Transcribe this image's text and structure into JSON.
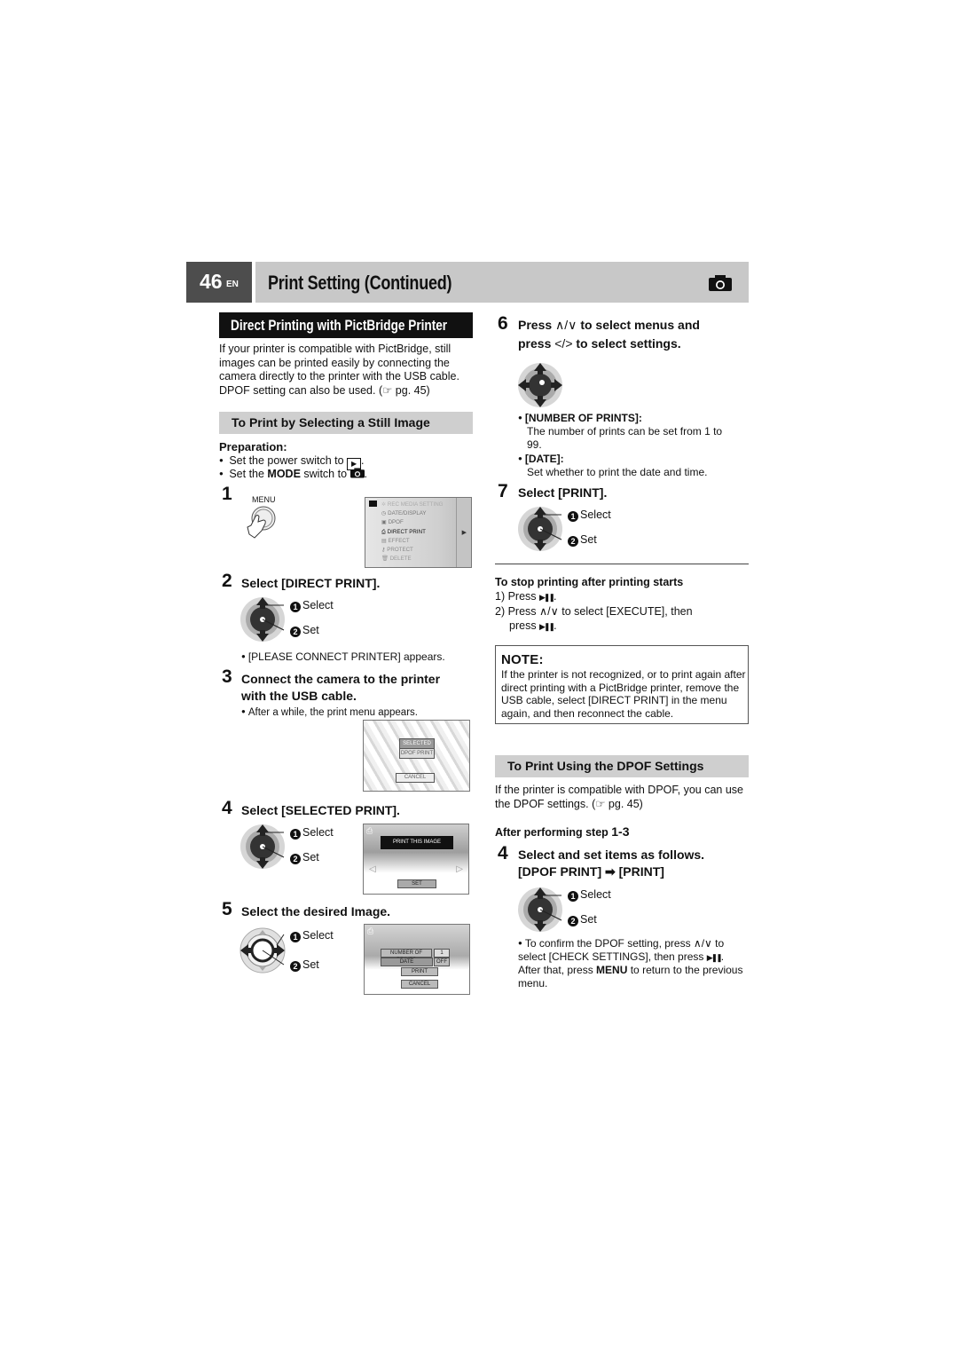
{
  "header": {
    "page_number": "46",
    "lang": "EN",
    "title": "Print Setting (Continued)",
    "icon": "camera-icon"
  },
  "left": {
    "section_title": "Direct Printing with PictBridge Printer",
    "intro": "If your printer is compatible with PictBridge, still images can be printed easily by connecting the camera directly to the printer with the USB cable. DPOF setting can also be used. (☞ pg. 45)",
    "subsection": "To Print by Selecting a Still Image",
    "preparation_label": "Preparation:",
    "prep_items": [
      {
        "pre": "Set the power switch to ",
        "icon": "playback-icon",
        "post": "."
      },
      {
        "pre": "Set the ",
        "bold": "MODE",
        "mid": " switch to ",
        "icon": "camera-icon",
        "post": "."
      }
    ],
    "step1": {
      "num": "1",
      "button_label": "MENU",
      "menu_items": [
        "REC MEDIA SETTING",
        "DATE/DISPLAY",
        "DPOF",
        "DIRECT PRINT",
        "EFFECT",
        "PROTECT",
        "DELETE"
      ],
      "selected_item": "DIRECT PRINT"
    },
    "step2": {
      "num": "2",
      "title": "Select [DIRECT PRINT].",
      "select_label": "Select",
      "set_label": "Set",
      "note": "[PLEASE CONNECT PRINTER] appears."
    },
    "step3": {
      "num": "3",
      "title_line1": "Connect the camera to the printer",
      "title_line2": "with the USB cable.",
      "note": "After a while, the print menu appears.",
      "screen_items": [
        "SELECTED PRINT",
        "DPOF PRINT",
        "CANCEL"
      ]
    },
    "step4": {
      "num": "4",
      "title": "Select [SELECTED PRINT].",
      "select_label": "Select",
      "set_label": "Set",
      "screen_banner": "PRINT THIS IMAGE",
      "screen_button": "SET"
    },
    "step5": {
      "num": "5",
      "title": "Select the desired Image.",
      "select_label": "Select",
      "set_label": "Set",
      "screen_rows": [
        {
          "label": "NUMBER OF PRINTS",
          "value": "1"
        },
        {
          "label": "DATE",
          "value": "OFF"
        }
      ],
      "screen_buttons": [
        "PRINT",
        "CANCEL"
      ]
    }
  },
  "right": {
    "step6": {
      "num": "6",
      "line1_pre": "Press ",
      "line1_icons": "∧/∨",
      "line1_post": " to select menus and",
      "line2_pre": "press ",
      "line2_icons": "</>",
      "line2_post": " to select settings.",
      "items": [
        {
          "label": "[NUMBER OF PRINTS]:",
          "desc_line1": "The number of prints can be set from 1 to",
          "desc_line2": "99."
        },
        {
          "label": "[DATE]:",
          "desc_line1": "Set whether to print the date and time."
        }
      ]
    },
    "step7": {
      "num": "7",
      "title": "Select [PRINT].",
      "select_label": "Select",
      "set_label": "Set"
    },
    "stop": {
      "title": "To stop printing after printing starts",
      "line1": "1) Press ",
      "line2_pre": "2) Press ",
      "line2_icons": "∧/∨",
      "line2_post": " to select [EXECUTE], then",
      "line3": "press "
    },
    "note": {
      "title": "NOTE:",
      "body": "If the printer is not recognized, or to print again after direct printing with a PictBridge printer, remove the USB cable, select [DIRECT PRINT] in the menu again, and then reconnect the cable."
    },
    "dpof": {
      "subsection": "To Print Using the DPOF Settings",
      "intro": "If the printer is compatible with DPOF, you can use the DPOF settings. (☞ pg. 45)",
      "after_label": "After performing step ",
      "after_steps": "1-3",
      "step4_num": "4",
      "step4_line1": "Select and set items as follows.",
      "step4_line2": "[DPOF PRINT] ➡ [PRINT]",
      "select_label": "Select",
      "set_label": "Set",
      "confirm_pre": "To confirm the DPOF setting, press ",
      "confirm_icons": "∧/∨",
      "confirm_mid": " to select [CHECK SETTINGS], then press ",
      "confirm_post1": ". After that, press ",
      "confirm_bold": "MENU",
      "confirm_post2": " to return to the previous menu."
    }
  }
}
